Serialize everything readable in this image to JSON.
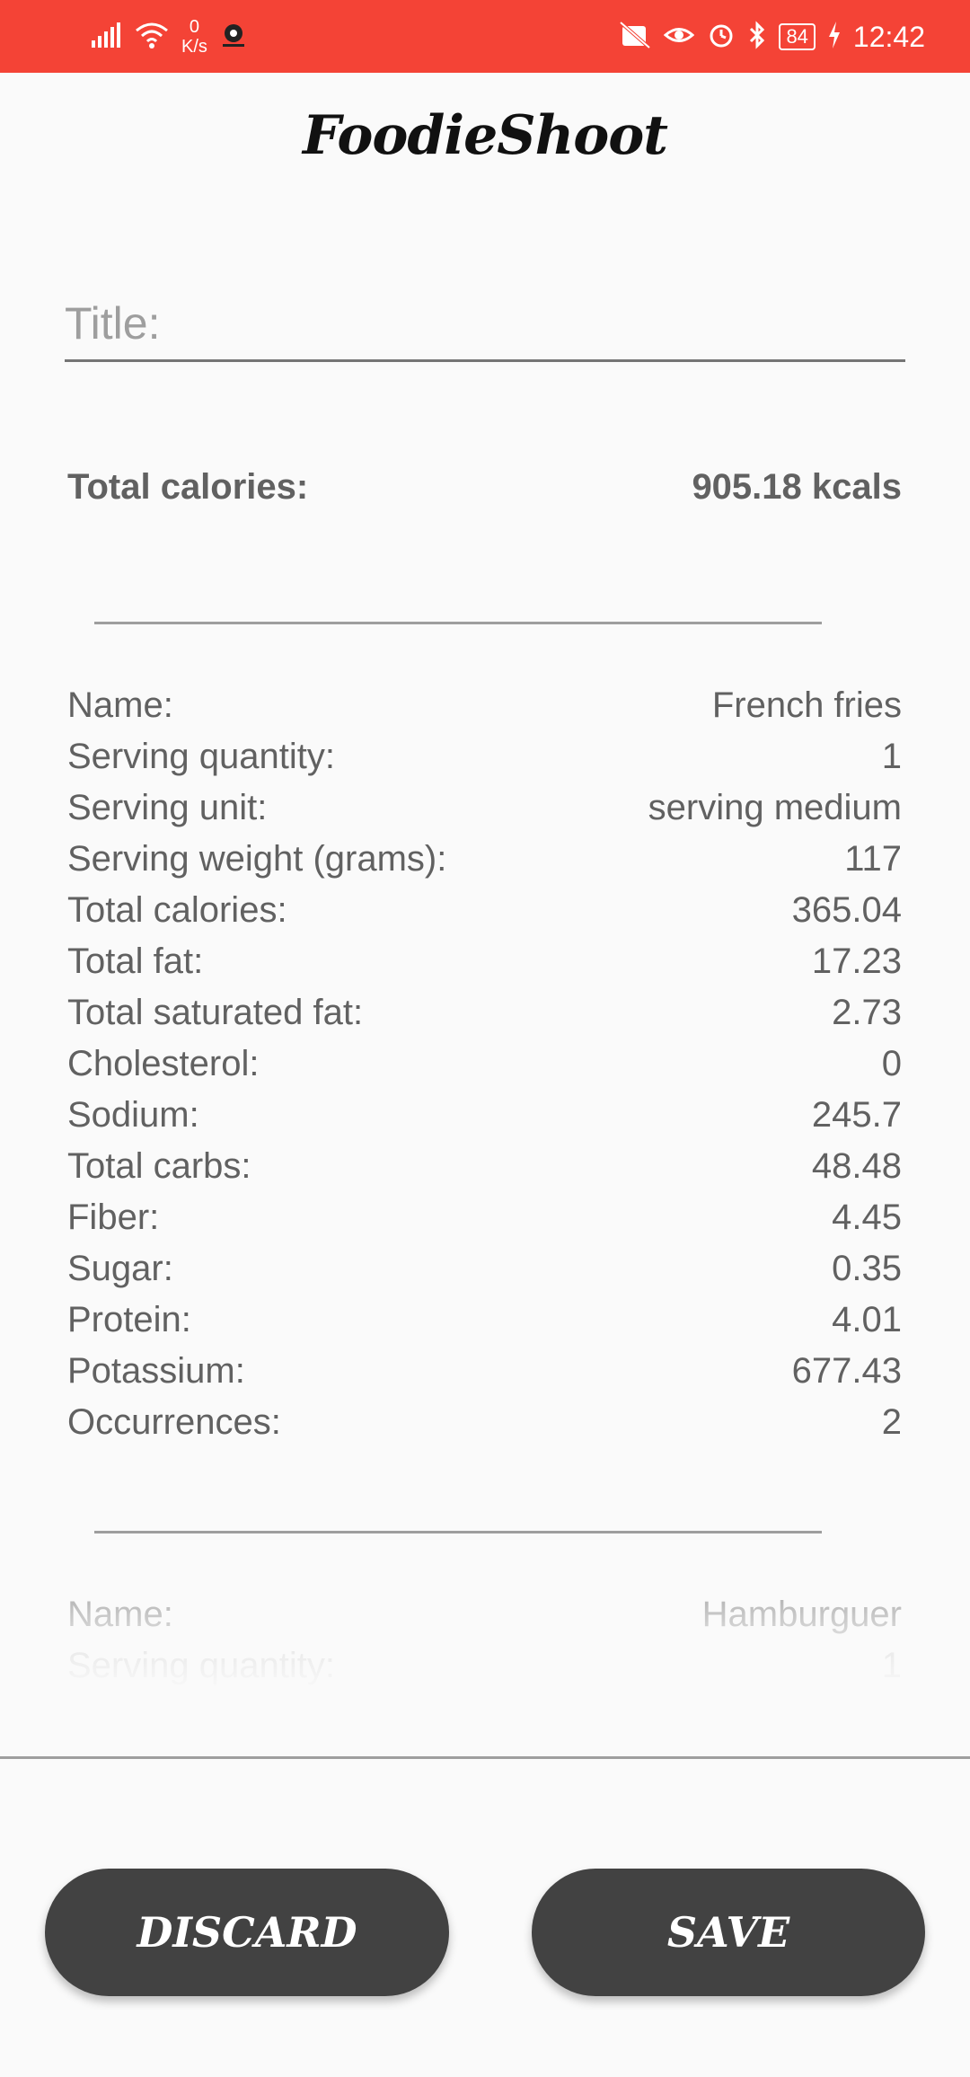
{
  "status_bar": {
    "net_speed_value": "0",
    "net_speed_unit": "K/s",
    "battery": "84",
    "time": "12:42"
  },
  "header": {
    "title": "FoodieShoot"
  },
  "form": {
    "title_placeholder": "Title:",
    "title_value": ""
  },
  "summary": {
    "total_calories_label": "Total calories:",
    "total_calories_value": "905.18 kcals"
  },
  "items": [
    {
      "rows": [
        {
          "label": "Name:",
          "value": "French fries"
        },
        {
          "label": "Serving quantity:",
          "value": "1"
        },
        {
          "label": "Serving unit:",
          "value": "serving medium"
        },
        {
          "label": "Serving weight (grams):",
          "value": "117"
        },
        {
          "label": "Total calories:",
          "value": "365.04"
        },
        {
          "label": "Total fat:",
          "value": "17.23"
        },
        {
          "label": "Total saturated fat:",
          "value": "2.73"
        },
        {
          "label": "Cholesterol:",
          "value": "0"
        },
        {
          "label": "Sodium:",
          "value": "245.7"
        },
        {
          "label": "Total carbs:",
          "value": "48.48"
        },
        {
          "label": "Fiber:",
          "value": "4.45"
        },
        {
          "label": "Sugar:",
          "value": "0.35"
        },
        {
          "label": "Protein:",
          "value": "4.01"
        },
        {
          "label": "Potassium:",
          "value": "677.43"
        },
        {
          "label": "Occurrences:",
          "value": "2"
        }
      ]
    },
    {
      "rows": [
        {
          "label": "Name:",
          "value": "Hamburguer"
        },
        {
          "label": "Serving quantity:",
          "value": "1"
        }
      ]
    }
  ],
  "actions": {
    "discard_label": "DISCARD",
    "save_label": "SAVE"
  },
  "colors": {
    "status_bar": "#f44336",
    "button": "#424242",
    "text": "#616161"
  }
}
